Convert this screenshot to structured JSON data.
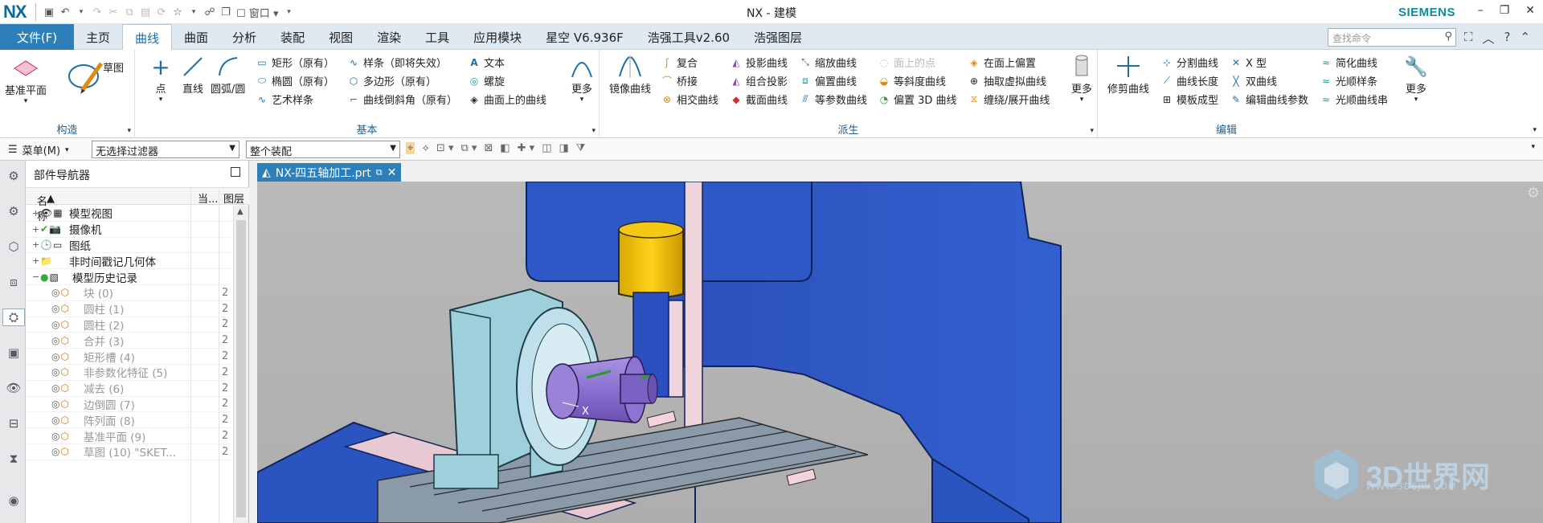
{
  "titlebar": {
    "logo": "NX",
    "window_label": "窗口",
    "title": "NX - 建模",
    "brand": "SIEMENS",
    "minimize": "–",
    "restore": "❐",
    "close": "✕"
  },
  "menubar": {
    "file": "文件(F)",
    "tabs": [
      "主页",
      "曲线",
      "曲面",
      "分析",
      "装配",
      "视图",
      "渲染",
      "工具",
      "应用模块",
      "星空 V6.936F",
      "浩强工具v2.60",
      "浩强图层"
    ],
    "active_tab": "曲线",
    "search_placeholder": "查找命令"
  },
  "ribbon": {
    "groups": {
      "construct": "构造",
      "basic": "基本",
      "derived": "派生",
      "edit": "编辑"
    },
    "construct": {
      "datum_plane": "基准平面",
      "sketch": "草图"
    },
    "basic": {
      "point": "点",
      "line": "直线",
      "arc": "圆弧/圆",
      "rect": "矩形（原有）",
      "ellipse": "椭圆（原有）",
      "art_spline": "艺术样条",
      "spline": "样条（即将失效）",
      "polygon": "多边形（原有）",
      "chamfer": "曲线倒斜角（原有）",
      "text": "文本",
      "helix": "螺旋",
      "curve_on_surface": "曲面上的曲线",
      "more": "更多"
    },
    "derived": {
      "mirror": "镜像曲线",
      "composite": "复合",
      "bridge": "桥接",
      "intersect": "相交曲线",
      "project": "投影曲线",
      "combined_project": "组合投影",
      "section": "截面曲线",
      "scale": "缩放曲线",
      "offset": "偏置曲线",
      "iso": "等参数曲线",
      "point_on_face": "面上的点",
      "slope": "等斜度曲线",
      "offset_3d": "偏置 3D 曲线",
      "offset_on_face": "在面上偏置",
      "extract_virtual": "抽取虚拟曲线",
      "wrap": "缠绕/展开曲线",
      "more": "更多"
    },
    "edit": {
      "trim": "修剪曲线",
      "divide": "分割曲线",
      "length": "曲线长度",
      "template": "模板成型",
      "x_type": "X 型",
      "double": "双曲线",
      "edit_params": "编辑曲线参数",
      "simplify": "简化曲线",
      "smooth_spline": "光顺样条",
      "smooth_string": "光顺曲线串",
      "more": "更多"
    }
  },
  "selectionbar": {
    "menu": "菜单(M)",
    "filter": "无选择过滤器",
    "scope": "整个装配"
  },
  "navigator": {
    "title": "部件导航器",
    "col_name": "名称",
    "col_current": "当...",
    "col_layer": "图层",
    "rows": [
      {
        "label": "模型视图",
        "exp": "+"
      },
      {
        "label": "摄像机",
        "exp": "+"
      },
      {
        "label": "图纸",
        "exp": "+"
      },
      {
        "label": "非时间戳记几何体",
        "exp": "+"
      },
      {
        "label": "模型历史记录",
        "exp": "−"
      },
      {
        "label": "块 (0)",
        "layer": "2"
      },
      {
        "label": "圆柱 (1)",
        "layer": "2"
      },
      {
        "label": "圆柱 (2)",
        "layer": "2"
      },
      {
        "label": "合并 (3)",
        "layer": "2"
      },
      {
        "label": "矩形槽 (4)",
        "layer": "2"
      },
      {
        "label": "非参数化特征 (5)",
        "layer": "2"
      },
      {
        "label": "减去 (6)",
        "layer": "2"
      },
      {
        "label": "边倒圆 (7)",
        "layer": "2"
      },
      {
        "label": "阵列面 (8)",
        "layer": "2"
      },
      {
        "label": "基准平面 (9)",
        "layer": "2"
      },
      {
        "label": "草图 (10) \"SKET...",
        "layer": "2"
      }
    ]
  },
  "document": {
    "tab": "NX-四五轴加工.prt"
  },
  "viewport": {
    "axis_label": "X",
    "watermark": "3D世界网",
    "watermark_sub": "WWW.3DSJW.COM"
  },
  "colors": {
    "accent": "#2c7fb8",
    "machine_blue": "#2a55c0",
    "viewport_bg": "#b4b4b4"
  }
}
